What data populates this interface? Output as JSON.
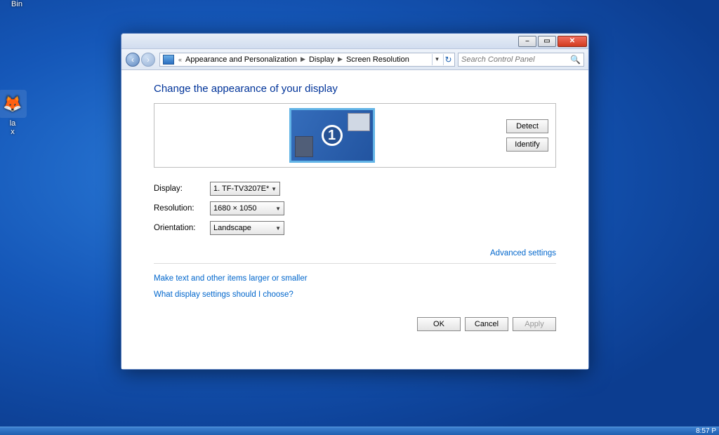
{
  "desktop": {
    "bin_label": "Bin",
    "firefox_label_line1": "la",
    "firefox_label_line2": "x"
  },
  "taskbar": {
    "time": "8:57 P"
  },
  "window": {
    "caption_buttons": {
      "min": "–",
      "max": "▭",
      "close": "✕"
    },
    "nav": {
      "back": "‹",
      "forward": "›"
    },
    "breadcrumbs": {
      "prefix": "«",
      "items": [
        "Appearance and Personalization",
        "Display",
        "Screen Resolution"
      ]
    },
    "search_placeholder": "Search Control Panel"
  },
  "page": {
    "heading": "Change the appearance of your display",
    "monitor_number": "1",
    "detect_label": "Detect",
    "identify_label": "Identify",
    "rows": {
      "display_label": "Display:",
      "display_value": "1. TF-TV3207E*",
      "resolution_label": "Resolution:",
      "resolution_value": "1680 × 1050",
      "orientation_label": "Orientation:",
      "orientation_value": "Landscape"
    },
    "advanced_link": "Advanced settings",
    "help_link1": "Make text and other items larger or smaller",
    "help_link2": "What display settings should I choose?",
    "ok_label": "OK",
    "cancel_label": "Cancel",
    "apply_label": "Apply"
  }
}
